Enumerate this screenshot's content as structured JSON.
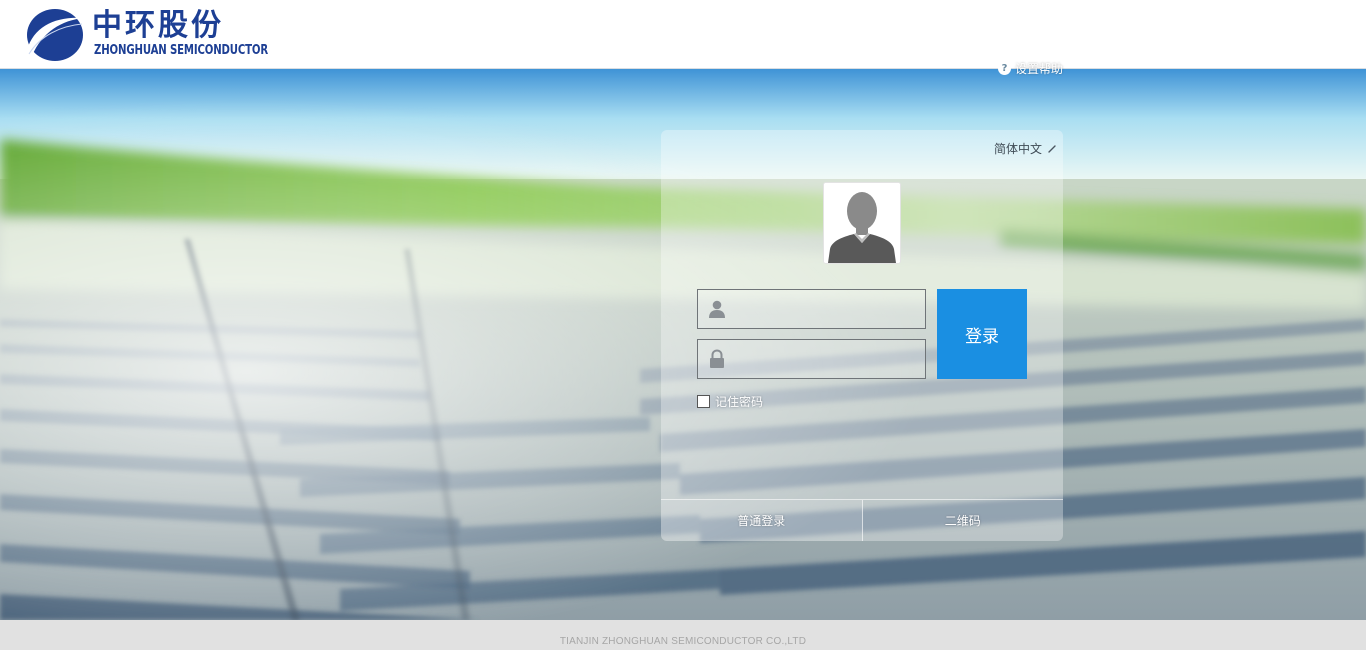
{
  "header": {
    "logo": {
      "cn_name": "中环股份",
      "en_name": "ZHONGHUAN SEMICONDUCTOR"
    }
  },
  "help": {
    "icon": "question-circle-icon",
    "label": "设置帮助"
  },
  "login": {
    "language": "简体中文",
    "language_icon": "pencil-icon",
    "avatar_icon": "default-user-avatar",
    "username": {
      "value": "",
      "placeholder": "",
      "icon": "user-icon"
    },
    "password": {
      "value": "",
      "placeholder": "",
      "icon": "lock-icon"
    },
    "submit_label": "登录",
    "remember_label": "记住密码",
    "remember_checked": false,
    "tabs": [
      {
        "label": "普通登录",
        "active": true
      },
      {
        "label": "二维码",
        "active": false
      }
    ]
  },
  "footer": {
    "copyright": "TIANJIN ZHONGHUAN SEMICONDUCTOR CO.,LTD"
  },
  "colors": {
    "brand_blue": "#1d3f94",
    "login_button": "#1a8fe2",
    "footer_bg": "#e1e1e1"
  }
}
